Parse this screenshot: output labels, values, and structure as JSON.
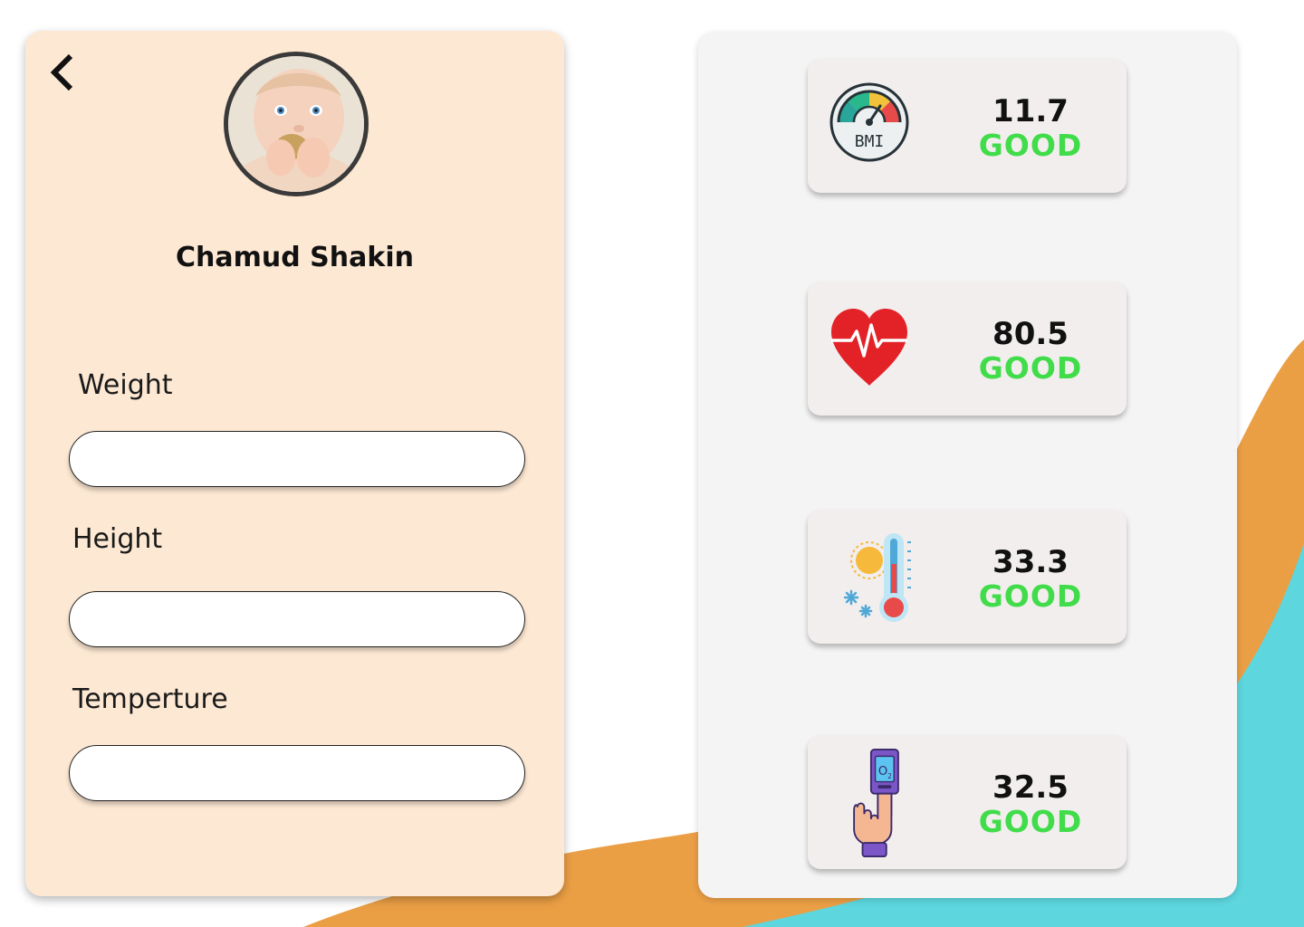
{
  "colors": {
    "left_panel_bg": "#fde8d3",
    "right_panel_bg": "#f4f4f4",
    "card_bg": "#f2eeee",
    "status_good": "#41dc4a",
    "wave_orange": "#eb9f45",
    "wave_teal": "#5dd6de"
  },
  "profile": {
    "back_icon": "chevron-left-icon",
    "avatar": "baby-photo",
    "name": "Chamud Shakin"
  },
  "form": {
    "weight_label": "Weight",
    "weight_value": "",
    "height_label": "Height",
    "height_value": "",
    "temperature_label": "Temperture",
    "temperature_value": ""
  },
  "metrics": [
    {
      "icon": "bmi-gauge-icon",
      "value": "11.7",
      "status": "GOOD"
    },
    {
      "icon": "heart-rate-icon",
      "value": "80.5",
      "status": "GOOD"
    },
    {
      "icon": "thermometer-icon",
      "value": "33.3",
      "status": "GOOD"
    },
    {
      "icon": "oximeter-icon",
      "value": "32.5",
      "status": "GOOD"
    }
  ]
}
